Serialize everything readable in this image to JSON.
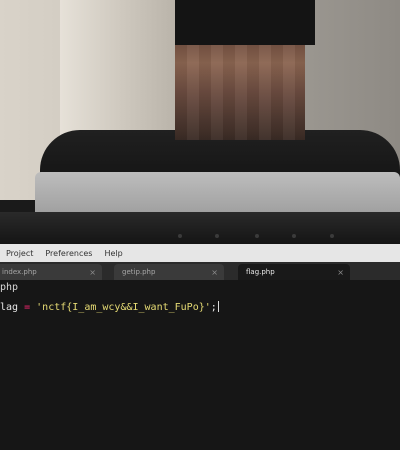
{
  "menu": {
    "items": [
      "Project",
      "Preferences",
      "Help"
    ]
  },
  "tabs": [
    {
      "label": "index.php",
      "close": "×"
    },
    {
      "label": "getip.php",
      "close": "×"
    },
    {
      "label": "flag.php",
      "close": "×",
      "active": true
    }
  ],
  "editor": {
    "file_label": "php",
    "code": {
      "var": "lag",
      "op": "=",
      "value": "'nctf{I_am_wcy&&I_want_FuPo}'",
      "terminator": ";"
    }
  }
}
